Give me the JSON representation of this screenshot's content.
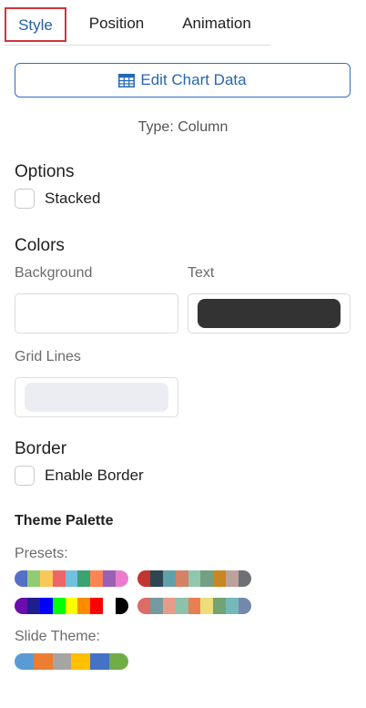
{
  "tabs": [
    {
      "label": "Style",
      "active": true
    },
    {
      "label": "Position",
      "active": false
    },
    {
      "label": "Animation",
      "active": false
    }
  ],
  "edit_button": {
    "label": "Edit Chart Data",
    "icon": "table-grid-icon"
  },
  "type_text": "Type: Column",
  "options": {
    "heading": "Options",
    "stacked_label": "Stacked",
    "stacked_checked": false
  },
  "colors": {
    "heading": "Colors",
    "background_label": "Background",
    "text_label": "Text",
    "grid_lines_label": "Grid Lines",
    "background_value": "#ffffff",
    "text_value": "#333333",
    "grid_lines_value": "#ebedf3"
  },
  "border": {
    "heading": "Border",
    "enable_label": "Enable Border",
    "enabled": false
  },
  "theme_palette": {
    "heading": "Theme Palette",
    "presets_label": "Presets:",
    "presets": [
      [
        "#5470c6",
        "#91cc75",
        "#fac858",
        "#ee6666",
        "#73c0de",
        "#3ba272",
        "#fc8452",
        "#9a60b4",
        "#ea7ccc"
      ],
      [
        "#c23531",
        "#2f4554",
        "#61a0a8",
        "#d48265",
        "#91c7ae",
        "#749f83",
        "#ca8622",
        "#bda29a",
        "#6e7074"
      ],
      [
        "#6a0dad",
        "#1e1e8f",
        "#0000ff",
        "#00ff00",
        "#ffff00",
        "#ff8c00",
        "#ff0000",
        "#ffffff",
        "#000000"
      ],
      [
        "#dd6b66",
        "#759aa0",
        "#e69d87",
        "#8dc1a9",
        "#ea7e53",
        "#eedd78",
        "#73a373",
        "#73b9bc",
        "#7289ab"
      ]
    ],
    "slide_theme_label": "Slide Theme:",
    "slide_theme": [
      "#5b9bd5",
      "#ed7d31",
      "#a5a5a5",
      "#ffc000",
      "#4472c4",
      "#70ad47"
    ]
  }
}
